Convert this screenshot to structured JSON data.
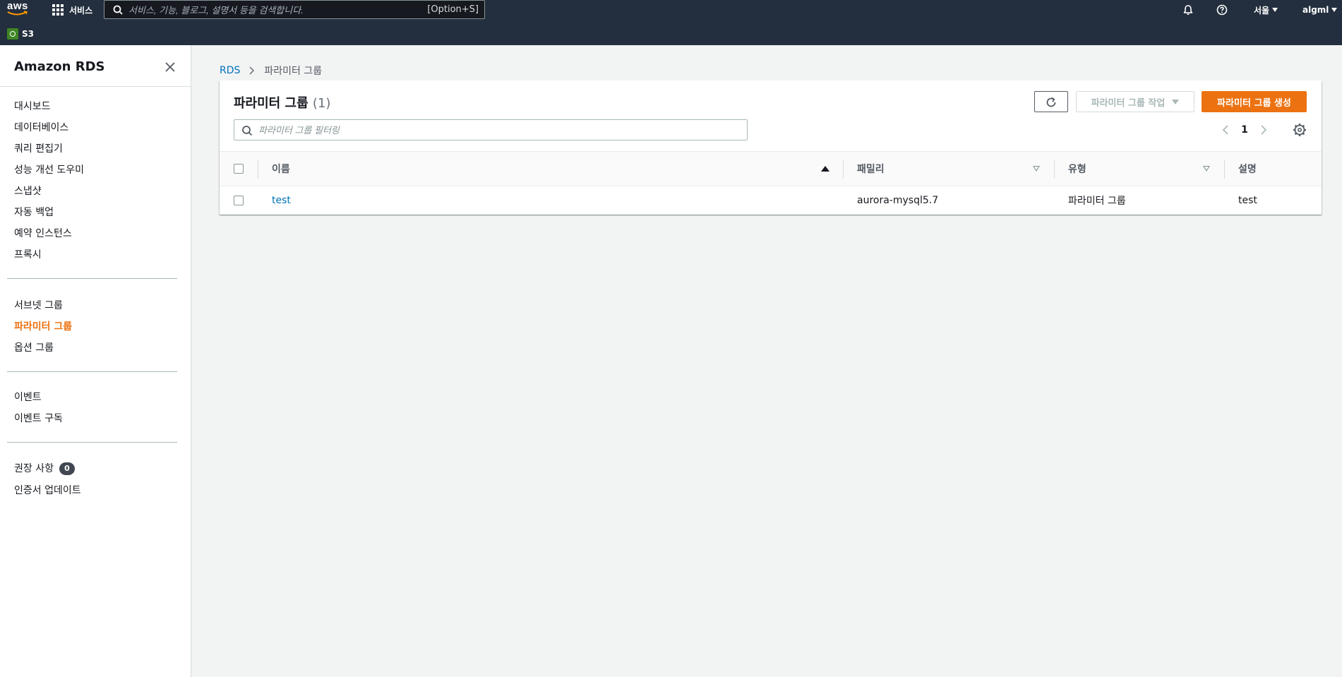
{
  "topnav": {
    "logo": "aws",
    "services_label": "서비스",
    "search_placeholder": "서비스, 기능, 블로그, 설명서 등을 검색합니다.",
    "search_shortcut": "[Option+S]",
    "region_label": "서울",
    "user_label": "algml",
    "favorites": [
      {
        "label": "S3",
        "icon": "s3-icon"
      }
    ]
  },
  "sidebar": {
    "title": "Amazon RDS",
    "group1": [
      "대시보드",
      "데이터베이스",
      "쿼리 편집기",
      "성능 개선 도우미",
      "스냅샷",
      "자동 백업",
      "예약 인스턴스",
      "프록시"
    ],
    "group2": [
      "서브넷 그룹",
      "파라미터 그룹",
      "옵션 그룹"
    ],
    "group3": [
      "이벤트",
      "이벤트 구독"
    ],
    "group4": {
      "recommendations": "권장 사항",
      "recommendations_count": "0",
      "cert_update": "인증서 업데이트"
    },
    "active_item": "파라미터 그룹",
    "active_color": "#ec7211"
  },
  "breadcrumb": {
    "root": "RDS",
    "current": "파라미터 그룹"
  },
  "panel": {
    "title": "파라미터 그룹",
    "count": "(1)",
    "actions_label": "파라미터 그룹 작업",
    "create_label": "파라미터 그룹 생성",
    "filter_placeholder": "파라미터 그룹 필터링",
    "page": "1"
  },
  "table": {
    "columns": [
      "이름",
      "패밀리",
      "유형",
      "설명"
    ],
    "rows": [
      {
        "name": "test",
        "family": "aurora-mysql5.7",
        "type": "파라미터 그룹",
        "description": "test"
      }
    ]
  },
  "colors": {
    "nav_bg": "#232f3e",
    "primary_button": "#ec7211",
    "link": "#0073bb"
  }
}
